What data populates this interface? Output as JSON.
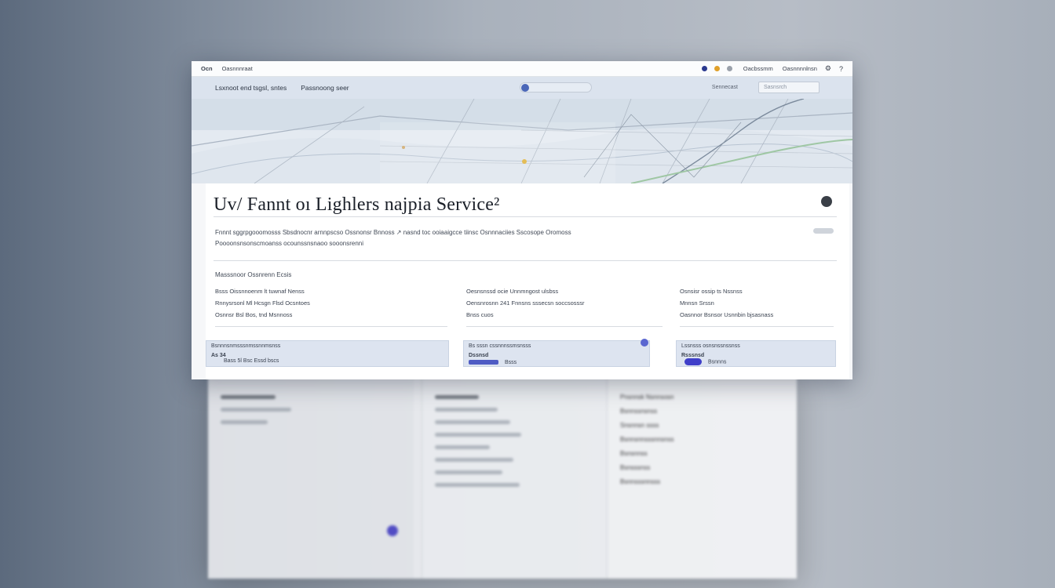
{
  "topbar": {
    "brand": "Ocn",
    "app_name": "Oasnnnraat",
    "email": "Oacbssmm",
    "account": "Oasnnnnlnsn",
    "dot_colors": [
      "#2b3a8f",
      "#e0a02a",
      "#9aa1ab"
    ]
  },
  "navbar": {
    "items": [
      "Lsxnoot end tsgsl, sntes",
      "Passnoong seer"
    ],
    "right_link": "Sennecast",
    "search_placeholder": "Sasnsrch"
  },
  "card": {
    "title": "Uv/ Fannt oı Lighlers najpia Service²",
    "description_line1": "Fnnnt sggrpgooomosss Sbsdnocnr arnnpscso Ossnonsr Bnnoss ↗ nasnd toc ooiaaigcce tiinsc Osnnnaciies Sscosope Oromoss",
    "description_line2": "Poooonsnsonscmoanss ocounssnsnaoo sooonsrenni",
    "section_label": "Masssnoor Ossnrenn Ecsis",
    "columns": [
      {
        "lines": [
          "Bsss Oissnnoenm lt tuwnaf Nenss",
          "Rnnysrsonl Ml Hcsgn Flsd Ocsntoes",
          "Osnnsr Bsl Bos, tnd Msnnoss"
        ]
      },
      {
        "lines": [
          "Oesnsnssd ocie Unnmngost ulsbss",
          "Oensnrosnn 241 Fnnsns sssecsn soccsosssr",
          "Bnss cuos"
        ]
      },
      {
        "lines": [
          "Osnsisr ossip ts Nssnss",
          "Mnnsn Srssn",
          "Oasnnor Bsnsor Usnnbin bjsasnass"
        ]
      }
    ],
    "tiles": [
      {
        "head": "Bsnnnsnmsssnmssnnmsnss",
        "sub1": "As 34",
        "sub2": "Bass 5l Bsc Essd bscs"
      },
      {
        "head": "Bs sssn cssnnnssmsnsss",
        "sub1": "Dssnsd",
        "sub2": "Bsss"
      },
      {
        "head": "Lssnsss osnsnssnssnss",
        "sub1": "Rsssnsd",
        "sub2": "Bsnnns"
      }
    ]
  },
  "backdrop": {
    "col1_lines": [
      "Bnssnnnosn",
      "Nosnrnsnss ocnnns"
    ],
    "col2_lines": [
      "Bsssnnsnnn",
      "Bssnnsnss occsns",
      "Bsssnnns 5sbss"
    ],
    "col3_lines": [
      "Pnsnnsk Nsnnsosn",
      "Bsnnssnsnss",
      "Snsnnsn ssss",
      "Bsnnsnnsssnnsnss",
      "Bsnsnnss",
      "Bsnsssnss",
      "Bsnnsssnnsss"
    ]
  },
  "colors": {
    "accent": "#4b45c6",
    "nav_bg": "#dbe3ee",
    "tile_bg": "#dde4f0"
  }
}
